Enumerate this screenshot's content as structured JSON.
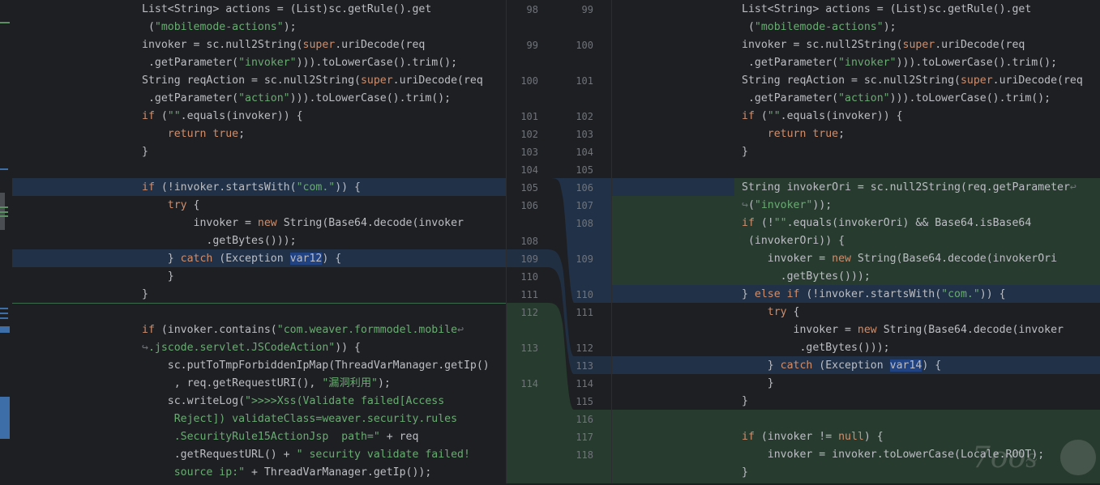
{
  "colors": {
    "background": "#1e1f22",
    "modified_block": "#213147",
    "added_block": "#283b2f",
    "keyword": "#cf8e6d",
    "string": "#6aab73",
    "selection": "#214283"
  },
  "left_lines": [
    [
      [
        "List<String> actions = (List)sc.getRule().get",
        ""
      ]
    ],
    [
      [
        " (",
        ""
      ],
      [
        "\"mobilemode-actions\"",
        "str"
      ],
      [
        ");",
        ""
      ]
    ],
    [
      [
        "invoker = sc.null2String(",
        ""
      ],
      [
        "super",
        "kw"
      ],
      [
        ".uriDecode(req",
        ""
      ]
    ],
    [
      [
        " .getParameter(",
        ""
      ],
      [
        "\"invoker\"",
        "str"
      ],
      [
        "))).toLowerCase().trim();",
        ""
      ]
    ],
    [
      [
        "String reqAction = sc.null2String(",
        ""
      ],
      [
        "super",
        "kw"
      ],
      [
        ".uriDecode(req",
        ""
      ]
    ],
    [
      [
        " .getParameter(",
        ""
      ],
      [
        "\"action\"",
        "str"
      ],
      [
        "))).toLowerCase().trim();",
        ""
      ]
    ],
    [
      [
        "if",
        "kw"
      ],
      [
        " (",
        ""
      ],
      [
        "\"\"",
        "str"
      ],
      [
        ".equals(invoker)) {",
        ""
      ]
    ],
    [
      [
        "    ",
        ""
      ],
      [
        "return true",
        "kw"
      ],
      [
        ";",
        ""
      ]
    ],
    [
      [
        "}",
        ""
      ]
    ],
    [
      [
        "",
        ""
      ]
    ],
    [
      [
        "if",
        "kw"
      ],
      [
        " (!invoker.startsWith(",
        ""
      ],
      [
        "\"com.\"",
        "str"
      ],
      [
        ")) {",
        ""
      ]
    ],
    [
      [
        "    ",
        ""
      ],
      [
        "try",
        "kw"
      ],
      [
        " {",
        ""
      ]
    ],
    [
      [
        "        invoker = ",
        ""
      ],
      [
        "new",
        "kw"
      ],
      [
        " String(Base64.decode(invoker",
        ""
      ]
    ],
    [
      [
        "          .getBytes()));",
        ""
      ]
    ],
    [
      [
        "    } ",
        ""
      ],
      [
        "catch",
        "kw"
      ],
      [
        " (Exception ",
        ""
      ],
      [
        "var12",
        "sel"
      ],
      [
        ") {",
        ""
      ]
    ],
    [
      [
        "    }",
        ""
      ]
    ],
    [
      [
        "}",
        ""
      ]
    ],
    [
      [
        "",
        ""
      ]
    ],
    [
      [
        "if",
        "kw"
      ],
      [
        " (invoker.contains(",
        ""
      ],
      [
        "\"com.weaver.formmodel.mobile",
        "str"
      ],
      [
        "↩",
        "wrap"
      ]
    ],
    [
      [
        "↪",
        "wrap"
      ],
      [
        ".jscode.servlet.JSCodeAction\"",
        "str"
      ],
      [
        ")) {",
        ""
      ]
    ],
    [
      [
        "    sc.putToTmpForbiddenIpMap(ThreadVarManager.getIp()",
        ""
      ]
    ],
    [
      [
        "     , req.getRequestURI(), ",
        ""
      ],
      [
        "\"漏洞利用\"",
        "str"
      ],
      [
        ");",
        ""
      ]
    ],
    [
      [
        "    sc.writeLog(",
        ""
      ],
      [
        "\">>>>Xss(Validate failed[Access",
        "str"
      ]
    ],
    [
      [
        "     ",
        ""
      ],
      [
        "Reject]) validateClass=weaver.security.rules",
        "str"
      ]
    ],
    [
      [
        "     ",
        ""
      ],
      [
        ".SecurityRule15ActionJsp  path=\"",
        "str"
      ],
      [
        " + req",
        ""
      ]
    ],
    [
      [
        "     .getRequestURL() + ",
        ""
      ],
      [
        "\" security validate failed!",
        "str"
      ]
    ],
    [
      [
        "     ",
        ""
      ],
      [
        "source ip:\"",
        "str"
      ],
      [
        " + ThreadVarManager.getIp());",
        ""
      ]
    ]
  ],
  "right_lines": [
    [
      [
        "List<String> actions = (List)sc.getRule().get",
        ""
      ]
    ],
    [
      [
        " (",
        ""
      ],
      [
        "\"mobilemode-actions\"",
        "str"
      ],
      [
        ");",
        ""
      ]
    ],
    [
      [
        "invoker = sc.null2String(",
        ""
      ],
      [
        "super",
        "kw"
      ],
      [
        ".uriDecode(req",
        ""
      ]
    ],
    [
      [
        " .getParameter(",
        ""
      ],
      [
        "\"invoker\"",
        "str"
      ],
      [
        "))).toLowerCase().trim();",
        ""
      ]
    ],
    [
      [
        "String reqAction = sc.null2String(",
        ""
      ],
      [
        "super",
        "kw"
      ],
      [
        ".uriDecode(req",
        ""
      ]
    ],
    [
      [
        " .getParameter(",
        ""
      ],
      [
        "\"action\"",
        "str"
      ],
      [
        "))).toLowerCase().trim();",
        ""
      ]
    ],
    [
      [
        "if",
        "kw"
      ],
      [
        " (",
        ""
      ],
      [
        "\"\"",
        "str"
      ],
      [
        ".equals(invoker)) {",
        ""
      ]
    ],
    [
      [
        "    ",
        ""
      ],
      [
        "return true",
        "kw"
      ],
      [
        ";",
        ""
      ]
    ],
    [
      [
        "}",
        ""
      ]
    ],
    [
      [
        "",
        ""
      ]
    ],
    [
      [
        "String invokerOri = sc.null2String(req.getParameter",
        ""
      ],
      [
        "↩",
        "wrap"
      ]
    ],
    [
      [
        "↪",
        "wrap"
      ],
      [
        "(",
        ""
      ],
      [
        "\"invoker\"",
        "str"
      ],
      [
        "));",
        ""
      ]
    ],
    [
      [
        "if",
        "kw"
      ],
      [
        " (!",
        ""
      ],
      [
        "\"\"",
        "str"
      ],
      [
        ".equals(invokerOri) && Base64.isBase64",
        ""
      ]
    ],
    [
      [
        " (invokerOri)) {",
        ""
      ]
    ],
    [
      [
        "    invoker = ",
        ""
      ],
      [
        "new",
        "kw"
      ],
      [
        " String(Base64.decode(invokerOri",
        ""
      ]
    ],
    [
      [
        "      .getBytes()));",
        ""
      ]
    ],
    [
      [
        "} ",
        ""
      ],
      [
        "else if",
        "kw"
      ],
      [
        " (!invoker.startsWith(",
        ""
      ],
      [
        "\"com.\"",
        "str"
      ],
      [
        ")) {",
        ""
      ]
    ],
    [
      [
        "    ",
        ""
      ],
      [
        "try",
        "kw"
      ],
      [
        " {",
        ""
      ]
    ],
    [
      [
        "        invoker = ",
        ""
      ],
      [
        "new",
        "kw"
      ],
      [
        " String(Base64.decode(invoker",
        ""
      ]
    ],
    [
      [
        "         .getBytes()));",
        ""
      ]
    ],
    [
      [
        "    } ",
        ""
      ],
      [
        "catch",
        "kw"
      ],
      [
        " (Exception ",
        ""
      ],
      [
        "var14",
        "sel"
      ],
      [
        ") {",
        ""
      ]
    ],
    [
      [
        "    }",
        ""
      ]
    ],
    [
      [
        "}",
        ""
      ]
    ],
    [
      [
        "",
        ""
      ]
    ],
    [
      [
        "if",
        "kw"
      ],
      [
        " (invoker != ",
        ""
      ],
      [
        "null",
        "kw"
      ],
      [
        ") {",
        ""
      ]
    ],
    [
      [
        "    invoker = invoker.toLowerCase(Locale.ROOT);",
        ""
      ]
    ],
    [
      [
        "}",
        ""
      ]
    ]
  ],
  "gutter_left_numbers": [
    "98",
    "",
    "99",
    "",
    "100",
    "",
    "101",
    "102",
    "103",
    "104",
    "105",
    "106",
    "",
    "108",
    "109",
    "110",
    "111",
    "112",
    "",
    "113",
    "",
    "114",
    "",
    "",
    "",
    ""
  ],
  "gutter_right_numbers": [
    "99",
    "",
    "100",
    "",
    "101",
    "",
    "102",
    "103",
    "104",
    "105",
    "106",
    "107",
    "108",
    "",
    "109",
    "",
    "110",
    "111",
    "",
    "112",
    "113",
    "114",
    "115",
    "116",
    "117",
    "118"
  ],
  "watermark": {
    "text": "7ooᵴ"
  }
}
